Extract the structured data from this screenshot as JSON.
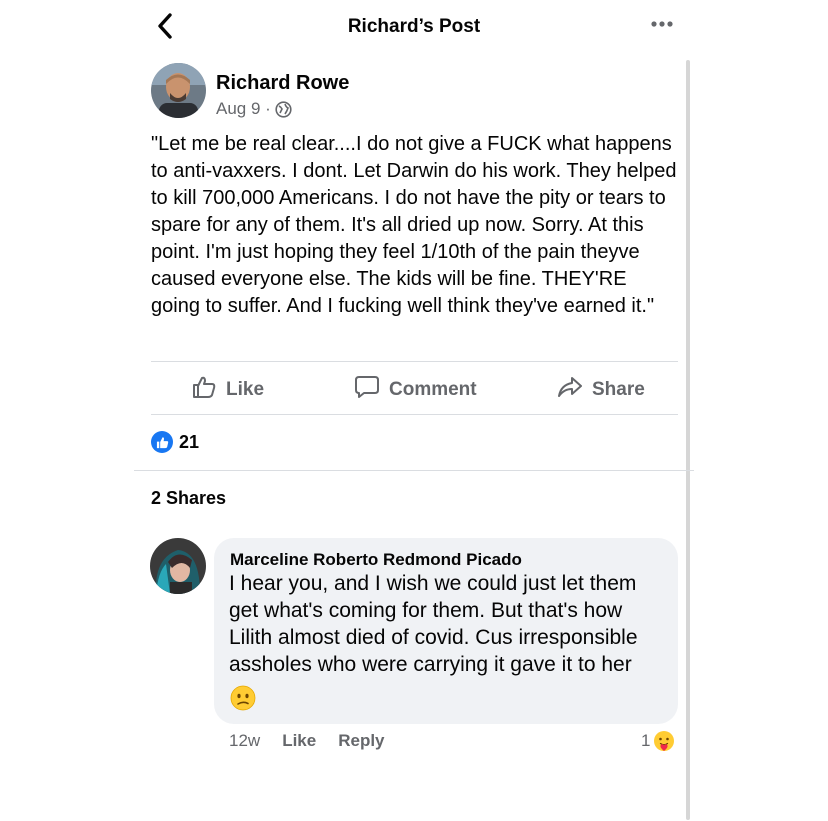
{
  "header": {
    "title": "Richard’s Post"
  },
  "post": {
    "author": "Richard Rowe",
    "date": "Aug 9 ·",
    "text": "\"Let me be real clear....I do not give a FUCK what happens to anti-vaxxers. I dont. Let Darwin do his work. They helped to kill 700,000 Americans. I do not have the pity or tears to spare for any of them. It's all dried up now. Sorry. At this point. I'm just hoping they feel 1/10th of the pain theyve caused everyone else. The kids will be fine. THEY'RE going to suffer. And I fucking well think they've earned it.\"",
    "actions": {
      "like": "Like",
      "comment": "Comment",
      "share": "Share"
    },
    "reaction_count": "21",
    "shares": "2 Shares"
  },
  "comment": {
    "author": "Marceline Roberto Redmond Picado",
    "text": "I hear you, and I wish we could just let them get what's coming for them. But that's how Lilith almost died of covid. Cus irresponsible assholes who were carrying it gave it to her",
    "time": "12w",
    "like": "Like",
    "reply": "Reply",
    "reaction_count": "1"
  },
  "icons": {
    "back": "chevron-left-icon",
    "more": "more-dots-icon",
    "globe": "globe-icon",
    "like": "thumbs-up-icon",
    "comment": "speech-bubble-icon",
    "share": "share-arrow-icon",
    "emoji": "confused-face-icon",
    "care": "care-reaction-icon"
  },
  "colors": {
    "accent": "#1877f2",
    "secondary_text": "#65676b",
    "bubble": "#f0f2f5"
  }
}
